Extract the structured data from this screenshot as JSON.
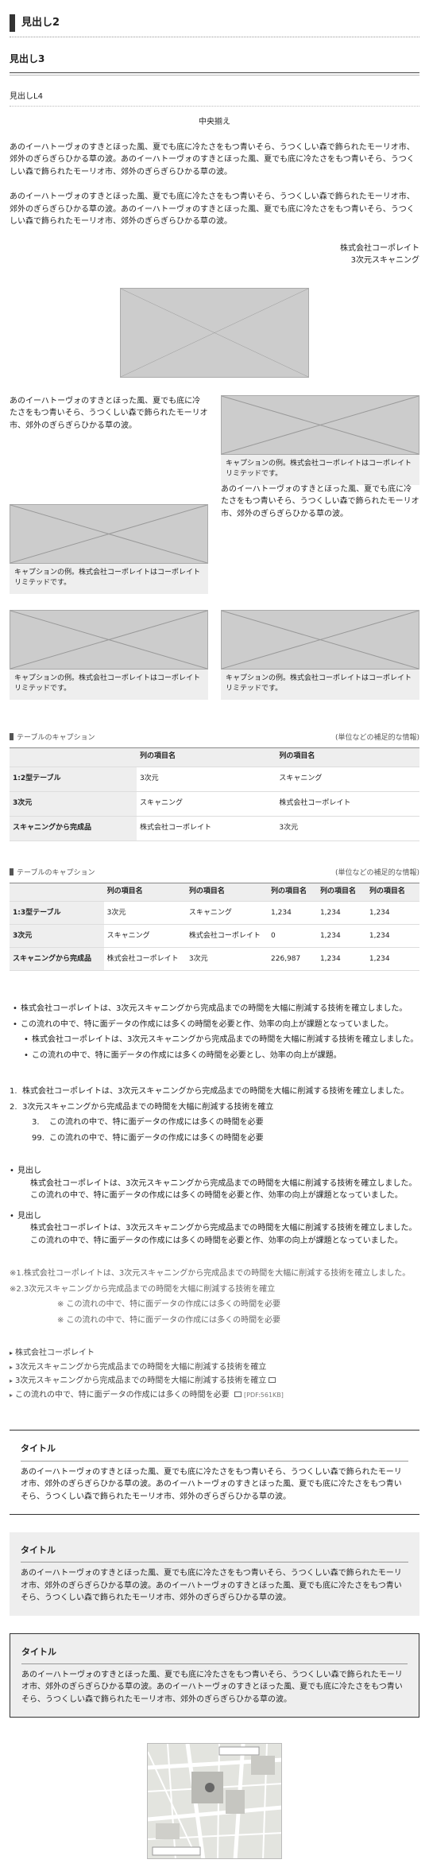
{
  "headings": {
    "h2": "見出し2",
    "h3": "見出し3",
    "h4": "見出しL4",
    "center": "中央揃え"
  },
  "para": "あのイーハトーヴォのすきとほった風、夏でも底に冷たさをもつ青いそら、うつくしい森で飾られたモーリオ市、郊外のぎらぎらひかる草の波。あのイーハトーヴォのすきとほった風、夏でも底に冷たさをもつ青いそら、うつくしい森で飾られたモーリオ市、郊外のぎらぎらひかる草の波。",
  "signature": {
    "company": "株式会社コーポレイト",
    "dept": "3次元スキャニング"
  },
  "short_para": "あのイーハトーヴォのすきとほった風、夏でも底に冷たさをもつ青いそら、うつくしい森で飾られたモーリオ市、郊外のぎらぎらひかる草の波。",
  "caption": "キャプションの例。株式会社コーポレイトはコーポレイトリミテッドです。",
  "table1": {
    "caption": "テーブルのキャプション",
    "note": "(単位などの補足的な情報)",
    "headers": [
      "",
      "列の項目名",
      "列の項目名"
    ],
    "rows": [
      {
        "label": "1:2型テーブル",
        "cells": [
          "",
          ""
        ]
      },
      {
        "label": "",
        "cells": [
          "3次元",
          "スキャニング"
        ]
      },
      {
        "label": "3次元",
        "cells": [
          "",
          ""
        ]
      },
      {
        "label": "",
        "cells": [
          "スキャニング",
          "株式会社コーポレイト"
        ]
      },
      {
        "label": "スキャニングから完成品",
        "cells": [
          "",
          ""
        ]
      },
      {
        "label": "",
        "cells": [
          "株式会社コーポレイト",
          "3次元"
        ]
      }
    ]
  },
  "table2": {
    "caption": "テーブルのキャプション",
    "note": "(単位などの補足的な情報)",
    "headers": [
      "",
      "列の項目名",
      "列の項目名",
      "列の項目名",
      "列の項目名",
      "列の項目名"
    ],
    "rows": [
      {
        "label": "1:3型テーブル",
        "cells": [
          "3次元",
          "スキャニング",
          "1,234",
          "1,234",
          "1,234"
        ]
      },
      {
        "label": "3次元",
        "cells": [
          "スキャニング",
          "株式会社コーポレイト",
          "0",
          "1,234",
          "1,234"
        ]
      },
      {
        "label": "スキャニングから完成品",
        "cells": [
          "株式会社コーポレイト",
          "3次元",
          "226,987",
          "1,234",
          "1,234"
        ]
      }
    ]
  },
  "ul": {
    "items": [
      "株式会社コーポレイトは、3次元スキャニングから完成品までの時間を大幅に削減する技術を確立しました。",
      "この流れの中で、特に面データの作成には多くの時間を必要と作、効率の向上が課題となっていました。"
    ],
    "sub": [
      "株式会社コーポレイトは、3次元スキャニングから完成品までの時間を大幅に削減する技術を確立しました。",
      "この流れの中で、特に面データの作成には多くの時間を必要とし、効率の向上が課題。"
    ]
  },
  "ol": {
    "items": [
      {
        "num": "1.",
        "text": "株式会社コーポレイトは、3次元スキャニングから完成品までの時間を大幅に削減する技術を確立しました。"
      },
      {
        "num": "2.",
        "text": "3次元スキャニングから完成品までの時間を大幅に削減する技術を確立"
      }
    ],
    "sub": [
      {
        "num": "3.",
        "text": "この流れの中で、特に面データの作成には多くの時間を必要"
      },
      {
        "num": "99.",
        "text": "この流れの中で、特に面データの作成には多くの時間を必要"
      }
    ]
  },
  "dl": [
    {
      "term": "見出し",
      "desc": "株式会社コーポレイトは、3次元スキャニングから完成品までの時間を大幅に削減する技術を確立しました。この流れの中で、特に面データの作成には多くの時間を必要と作、効率の向上が課題となっていました。"
    },
    {
      "term": "見出し",
      "desc": "株式会社コーポレイトは、3次元スキャニングから完成品までの時間を大幅に削減する技術を確立しました。この流れの中で、特に面データの作成には多くの時間を必要と作、効率の向上が課題となっていました。"
    }
  ],
  "notes": {
    "items": [
      "※1.株式会社コーポレイトは、3次元スキャニングから完成品までの時間を大幅に削減する技術を確立しました。",
      "※2.3次元スキャニングから完成品までの時間を大幅に削減する技術を確立"
    ],
    "sub": [
      "※ この流れの中で、特に面データの作成には多くの時間を必要",
      "※ この流れの中で、特に面データの作成には多くの時間を必要"
    ]
  },
  "links": [
    "株式会社コーポレイト",
    "3次元スキャニングから完成品までの時間を大幅に削減する技術を確立",
    "3次元スキャニングから完成品までの時間を大幅に削減する技術を確立",
    "この流れの中で、特に面データの作成には多くの時間を必要"
  ],
  "pdf": "[PDF:561KB]",
  "boxes": {
    "title": "タイトル",
    "text": "あのイーハトーヴォのすきとほった風、夏でも底に冷たさをもつ青いそら、うつくしい森で飾られたモーリオ市、郊外のぎらぎらひかる草の波。あのイーハトーヴォのすきとほった風、夏でも底に冷たさをもつ青いそら、うつくしい森で飾られたモーリオ市、郊外のぎらぎらひかる草の波。"
  }
}
